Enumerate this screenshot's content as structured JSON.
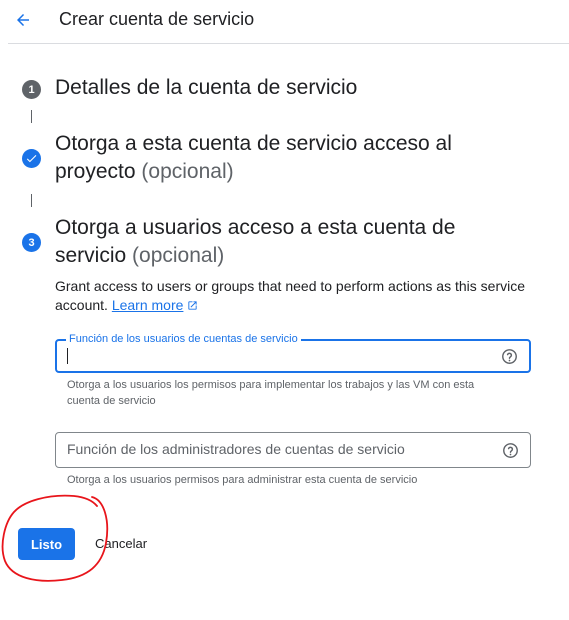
{
  "header": {
    "back_icon": "arrow-back-icon",
    "title": "Crear cuenta de servicio"
  },
  "colors": {
    "accent": "#1a73e8",
    "step_inactive": "#5f6368",
    "annotation": "#e8151b"
  },
  "steps": [
    {
      "number": "1",
      "status": "inactive",
      "title": "Detalles de la cuenta de servicio",
      "optional": ""
    },
    {
      "number": "2",
      "status": "completed",
      "icon": "check-icon",
      "title": "Otorga a esta cuenta de servicio acceso al proyecto",
      "optional": "(opcional)"
    },
    {
      "number": "3",
      "status": "active",
      "title": "Otorga a usuarios acceso a esta cuenta de servicio",
      "optional": "(opcional)"
    }
  ],
  "step3": {
    "description": "Grant access to users or groups that need to perform actions as this service account.",
    "learn_more": "Learn more",
    "learn_more_icon": "open-in-new-icon"
  },
  "fields": {
    "users_role": {
      "label": "Función de los usuarios de cuentas de servicio",
      "value": "",
      "hint": "Otorga a los usuarios los permisos para implementar los trabajos y las VM con esta cuenta de servicio",
      "help_icon": "help-icon"
    },
    "admins_role": {
      "placeholder": "Función de los administradores de cuentas de servicio",
      "value": "",
      "hint": "Otorga a los usuarios permisos para administrar esta cuenta de servicio",
      "help_icon": "help-icon"
    }
  },
  "actions": {
    "done_label": "Listo",
    "cancel_label": "Cancelar"
  }
}
